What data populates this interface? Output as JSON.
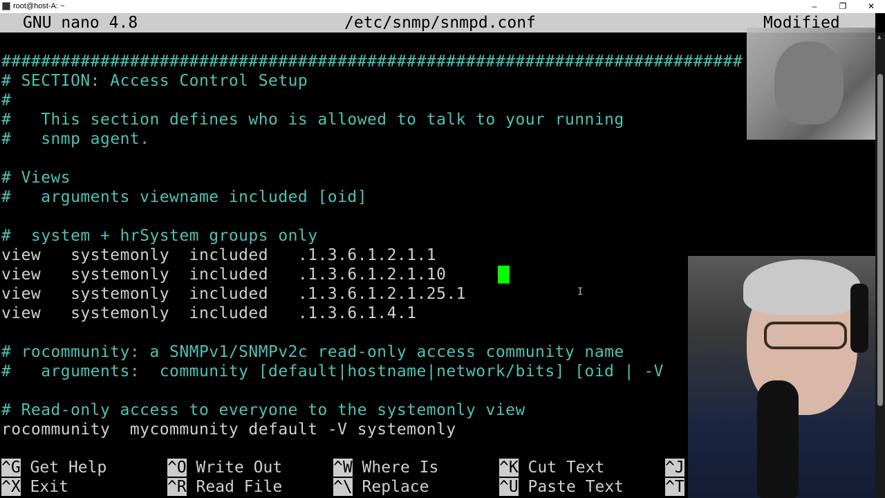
{
  "window": {
    "title": "root@host-A: ~",
    "buttons": {
      "minimize": "–",
      "maximize": "❐",
      "close": "✕"
    }
  },
  "nano": {
    "version": "GNU nano 4.8",
    "filename": "/etc/snmp/snmpd.conf",
    "status": "Modified"
  },
  "editor": {
    "lines": [
      {
        "text": "",
        "kind": "t"
      },
      {
        "text": "###########################################################################",
        "kind": "c"
      },
      {
        "text": "# SECTION: Access Control Setup",
        "kind": "c"
      },
      {
        "text": "#",
        "kind": "c"
      },
      {
        "text": "#   This section defines who is allowed to talk to your running",
        "kind": "c"
      },
      {
        "text": "#   snmp agent.",
        "kind": "c"
      },
      {
        "text": "",
        "kind": "t"
      },
      {
        "text": "# Views",
        "kind": "c"
      },
      {
        "text": "#   arguments viewname included [oid]",
        "kind": "c"
      },
      {
        "text": "",
        "kind": "t"
      },
      {
        "text": "#  system + hrSystem groups only",
        "kind": "c"
      },
      {
        "text": "view   systemonly  included   .1.3.6.1.2.1.1",
        "kind": "t"
      },
      {
        "text": "view   systemonly  included   .1.3.6.1.2.1.10",
        "kind": "t"
      },
      {
        "text": "view   systemonly  included   .1.3.6.1.2.1.25.1",
        "kind": "t"
      },
      {
        "text": "view   systemonly  included   .1.3.6.1.4.1",
        "kind": "t"
      },
      {
        "text": "",
        "kind": "t"
      },
      {
        "text": "# rocommunity: a SNMPv1/SNMPv2c read-only access community name",
        "kind": "c"
      },
      {
        "text": "#   arguments:  community [default|hostname|network/bits] [oid | -V",
        "kind": "c"
      },
      {
        "text": "",
        "kind": "t"
      },
      {
        "text": "# Read-only access to everyone to the systemonly view",
        "kind": "c"
      },
      {
        "text": "rocommunity  mycommunity default -V systemonly",
        "kind": "t"
      }
    ]
  },
  "shortcuts": [
    {
      "key": "^G",
      "label": " Get Help"
    },
    {
      "key": "^O",
      "label": " Write Out"
    },
    {
      "key": "^W",
      "label": " Where Is"
    },
    {
      "key": "^K",
      "label": " Cut Text"
    },
    {
      "key": "^J",
      "label": ""
    },
    {
      "key": "^X",
      "label": " Exit"
    },
    {
      "key": "^R",
      "label": " Read File"
    },
    {
      "key": "^\\",
      "label": " Replace"
    },
    {
      "key": "^U",
      "label": " Paste Text"
    },
    {
      "key": "^T",
      "label": ""
    }
  ],
  "colors": {
    "comment": "#4fc1b4",
    "text": "#d0d0d0",
    "cursor": "#00ff00",
    "header_bg": "#cccccc",
    "background": "#000000"
  }
}
